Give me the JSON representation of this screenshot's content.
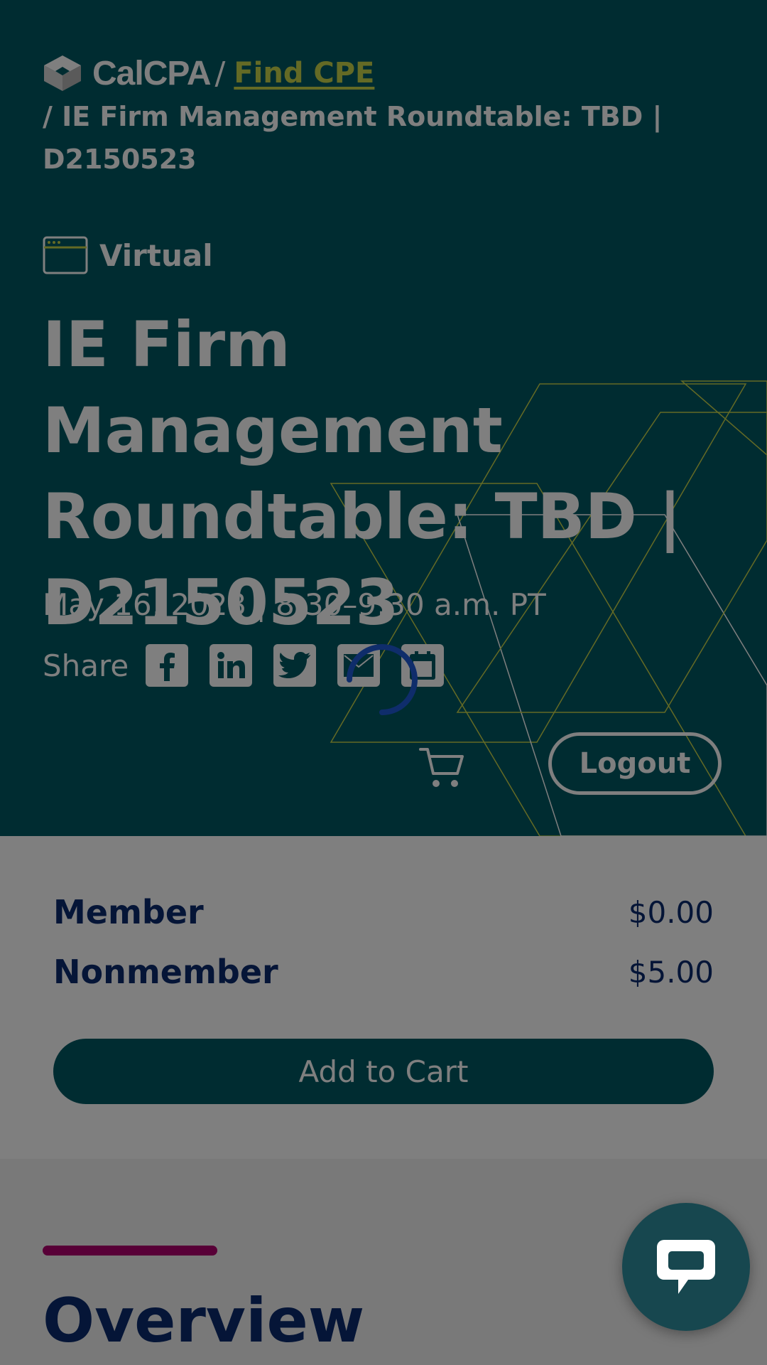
{
  "header": {
    "logo_text": "CalCPA",
    "breadcrumb_sep": "/",
    "find_cpe": "Find CPE",
    "current_page": "/ IE Firm Management Roundtable: TBD | D2150523"
  },
  "event": {
    "format": "Virtual",
    "title": "IE Firm Management Roundtable: TBD | D2150523",
    "date": "May 16, 2023 | 8:30–9:30 a.m. PT"
  },
  "share": {
    "label": "Share",
    "buttons": [
      "facebook-icon",
      "linkedin-icon",
      "twitter-icon",
      "email-icon",
      "calendar-icon"
    ]
  },
  "account": {
    "logout": "Logout"
  },
  "pricing": {
    "member_label": "Member",
    "member_price": "$0.00",
    "nonmember_label": "Nonmember",
    "nonmember_price": "$5.00",
    "add_to_cart": "Add to Cart"
  },
  "overview": {
    "heading": "Overview"
  },
  "colors": {
    "hero_bg": "#005862",
    "brand_lime": "#c9d44a",
    "navy": "#0a2a6e",
    "accent_magenta": "#b0006e",
    "overlay": "rgba(0,0,0,0.5)"
  },
  "state": {
    "loading": true
  }
}
